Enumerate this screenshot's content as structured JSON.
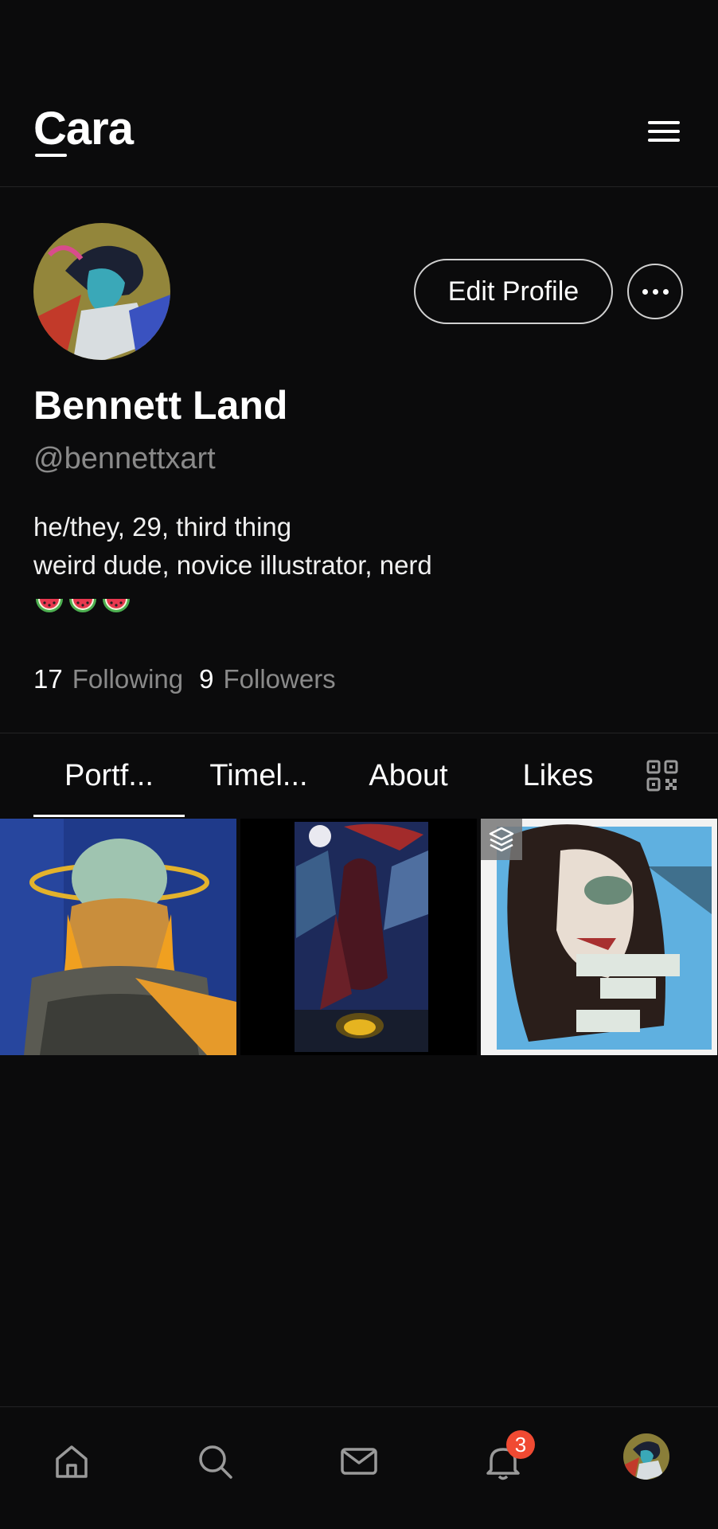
{
  "app": {
    "logo": "Cara"
  },
  "profile": {
    "name": "Bennett Land",
    "handle": "@bennettxart",
    "bio_line1": "he/they, 29, third thing",
    "bio_line2": "weird dude, novice illustrator, nerd",
    "edit_label": "Edit Profile",
    "following_count": "17",
    "following_label": "Following",
    "followers_count": "9",
    "followers_label": "Followers"
  },
  "tabs": [
    {
      "label": "Portf..."
    },
    {
      "label": "Timel..."
    },
    {
      "label": "About"
    },
    {
      "label": "Likes"
    }
  ],
  "notifications": {
    "badge_count": "3"
  },
  "colors": {
    "background": "#0b0b0c",
    "badge": "#f04a32",
    "muted_text": "#8a8a8a"
  }
}
